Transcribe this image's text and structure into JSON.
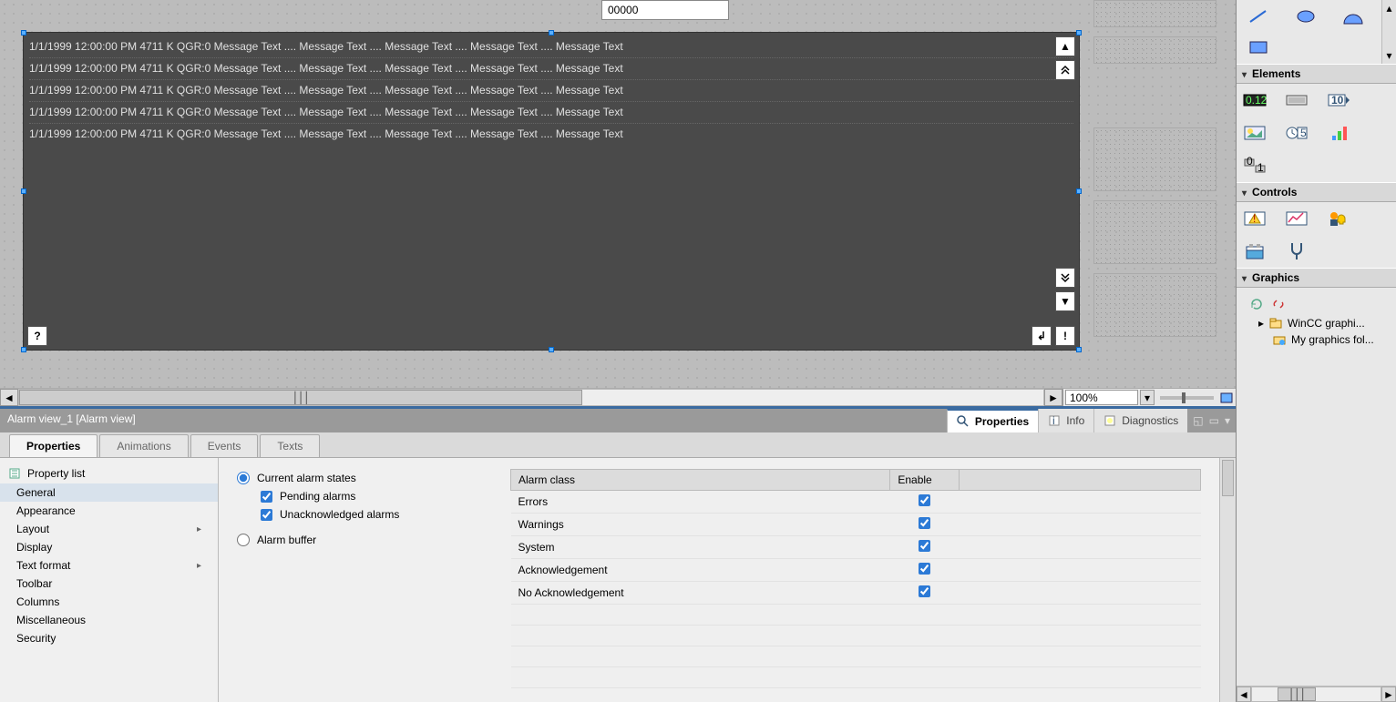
{
  "canvas": {
    "input_value": "00000",
    "alarm_lines": [
      "1/1/1999 12:00:00 PM  4711 K QGR:0 Message Text .... Message Text .... Message Text .... Message Text .... Message Text",
      "1/1/1999 12:00:00 PM  4711 K QGR:0 Message Text .... Message Text .... Message Text .... Message Text .... Message Text",
      "1/1/1999 12:00:00 PM  4711 K QGR:0 Message Text .... Message Text .... Message Text .... Message Text .... Message Text",
      "1/1/1999 12:00:00 PM  4711 K QGR:0 Message Text .... Message Text .... Message Text .... Message Text .... Message Text",
      "1/1/1999 12:00:00 PM  4711 K QGR:0 Message Text .... Message Text .... Message Text .... Message Text .... Message Text"
    ],
    "btn_up": "▲",
    "btn_up_double": "⯬",
    "btn_down_double": "⯭",
    "btn_down": "▼",
    "btn_help": "?",
    "btn_enter": "↲",
    "btn_bang": "!",
    "scroll_left": "◄",
    "scroll_right": "►",
    "zoom_value": "100%"
  },
  "properties": {
    "title": "Alarm view_1 [Alarm view]",
    "header_tabs": {
      "properties": "Properties",
      "info": "Info",
      "diagnostics": "Diagnostics"
    },
    "tabs": {
      "properties": "Properties",
      "animations": "Animations",
      "events": "Events",
      "texts": "Texts"
    },
    "list_header": "Property list",
    "list_items": [
      {
        "label": "General",
        "active": true,
        "arrow": false
      },
      {
        "label": "Appearance",
        "active": false,
        "arrow": false
      },
      {
        "label": "Layout",
        "active": false,
        "arrow": true
      },
      {
        "label": "Display",
        "active": false,
        "arrow": false
      },
      {
        "label": "Text format",
        "active": false,
        "arrow": true
      },
      {
        "label": "Toolbar",
        "active": false,
        "arrow": false
      },
      {
        "label": "Columns",
        "active": false,
        "arrow": false
      },
      {
        "label": "Miscellaneous",
        "active": false,
        "arrow": false
      },
      {
        "label": "Security",
        "active": false,
        "arrow": false
      }
    ],
    "radios": {
      "current": "Current alarm states",
      "pending": "Pending alarms",
      "unack": "Unacknowledged alarms",
      "buffer": "Alarm buffer"
    },
    "class_table": {
      "cols": {
        "class": "Alarm class",
        "enable": "Enable"
      },
      "rows": [
        {
          "class": "Errors",
          "enable": true
        },
        {
          "class": "Warnings",
          "enable": true
        },
        {
          "class": "System",
          "enable": true
        },
        {
          "class": "Acknowledgement",
          "enable": true
        },
        {
          "class": "No Acknowledgement",
          "enable": true
        }
      ]
    }
  },
  "toolbox": {
    "elements_title": "Elements",
    "controls_title": "Controls",
    "graphics_title": "Graphics",
    "graphics_items": [
      "WinCC graphi...",
      "My graphics fol..."
    ]
  }
}
